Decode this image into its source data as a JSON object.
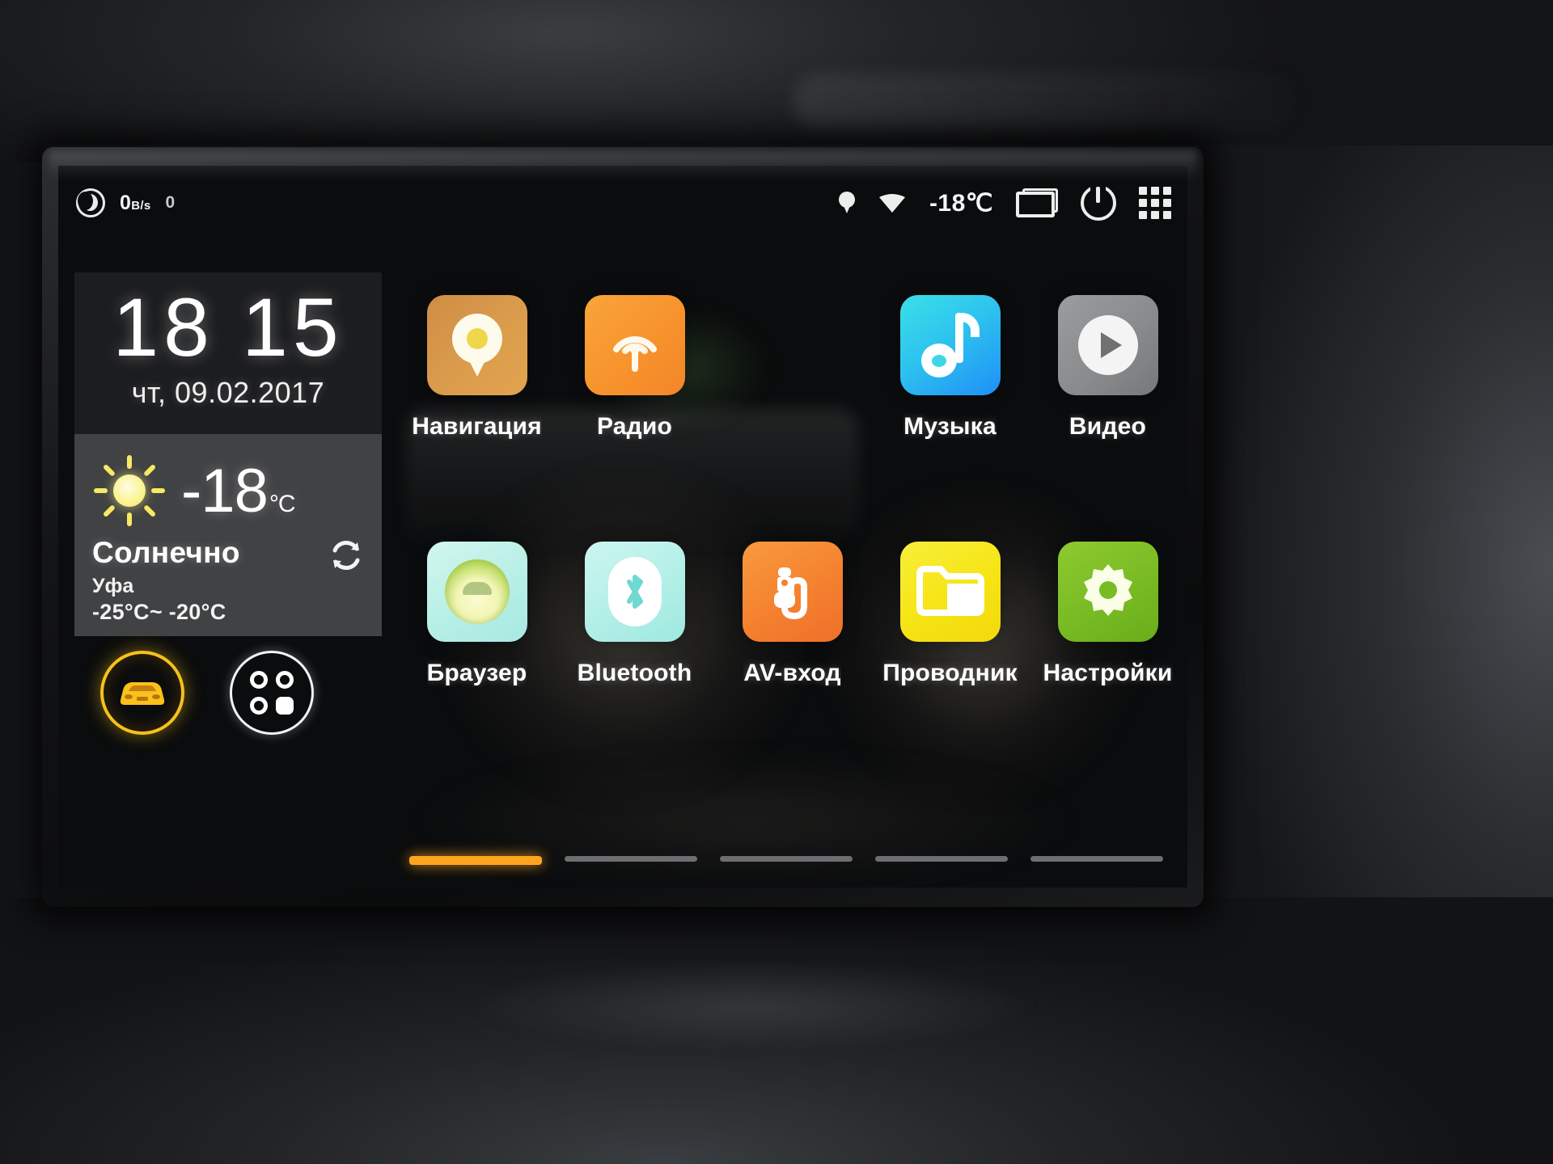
{
  "status_bar": {
    "dnd_icon": "crescent-moon-icon",
    "network_speed": "0",
    "network_speed_unit": "B/s",
    "notification_count": "0",
    "gps_icon": "location-pin-icon",
    "wifi_icon": "wifi-icon",
    "temperature": "-18℃",
    "recents_icon": "recent-apps-icon",
    "power_icon": "power-icon",
    "app_drawer_icon": "app-grid-icon"
  },
  "clock_widget": {
    "hours": "18",
    "minutes": "15",
    "time": "18 15",
    "date": "чт, 09.02.2017"
  },
  "weather_widget": {
    "icon": "sun-icon",
    "temperature": "-18",
    "unit": "°C",
    "condition": "Солнечно",
    "city": "Уфа",
    "range": "-25°C~ -20°C",
    "refresh_icon": "refresh-icon"
  },
  "shortcuts": [
    {
      "name": "car-info-button",
      "icon": "car-icon",
      "active": true
    },
    {
      "name": "all-apps-button",
      "icon": "four-dots-icon",
      "active": false
    }
  ],
  "apps": {
    "row1": [
      {
        "label": "Навигация",
        "icon": "map-pin-icon",
        "color": "#d9904a"
      },
      {
        "label": "Радио",
        "icon": "radio-broadcast-icon",
        "color": "#f79a2e"
      },
      {
        "label": "",
        "icon": "",
        "color": ""
      },
      {
        "label": "Музыка",
        "icon": "music-note-icon",
        "color": "#29c8e8"
      },
      {
        "label": "Видео",
        "icon": "video-play-icon",
        "color": "#8a8c8e"
      }
    ],
    "row2": [
      {
        "label": "Браузер",
        "icon": "globe-icon",
        "color": "#bdf0ea"
      },
      {
        "label": "Bluetooth",
        "icon": "bluetooth-icon",
        "color": "#b8efe8"
      },
      {
        "label": "AV-вход",
        "icon": "av-plug-icon",
        "color": "#f4812f"
      },
      {
        "label": "Проводник",
        "icon": "folder-icon",
        "color": "#f5e611"
      },
      {
        "label": "Настройки",
        "icon": "gear-icon",
        "color": "#79bb23"
      }
    ]
  },
  "pages": {
    "total": 5,
    "active_index": 1
  },
  "colors": {
    "accent": "#ffa51f",
    "car_button": "#f5c21b",
    "screen_bg": "#0b0c0d",
    "text": "#ffffff"
  }
}
